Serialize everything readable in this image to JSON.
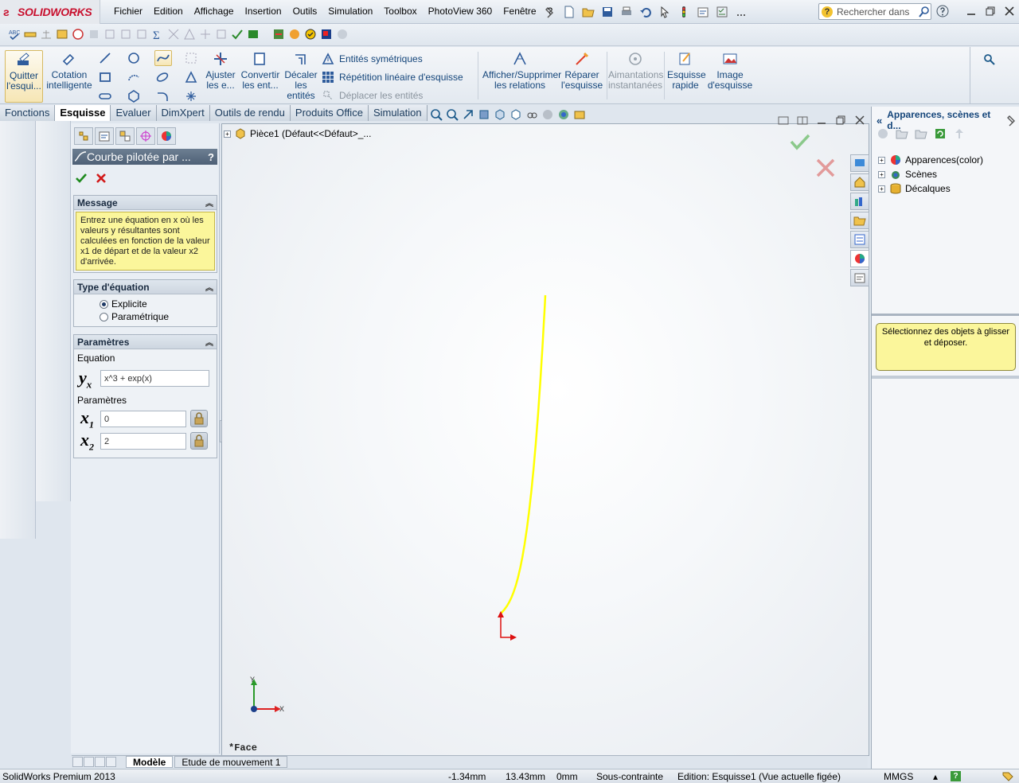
{
  "app": {
    "brand": "SOLIDWORKS",
    "product": "SolidWorks Premium 2013"
  },
  "menu": [
    "Fichier",
    "Edition",
    "Affichage",
    "Insertion",
    "Outils",
    "Simulation",
    "Toolbox",
    "PhotoView 360",
    "Fenêtre",
    "?"
  ],
  "search": {
    "placeholder": "Rechercher dans"
  },
  "ribbon": {
    "quit": "Quitter l'esqui...",
    "smartdim": "Cotation intelligente",
    "trim": "Ajuster les e...",
    "convert": "Convertir les ent...",
    "offset": "Décaler les entités",
    "mirror": "Entités symétriques",
    "linear": "Répétition linéaire d'esquisse",
    "move": "Déplacer les entités",
    "relations": "Afficher/Supprimer les relations",
    "repair": "Réparer l'esquisse",
    "snaps": "Aimantations instantanées",
    "quick": "Esquisse rapide",
    "picture": "Image d'esquisse"
  },
  "tabs": [
    "Fonctions",
    "Esquisse",
    "Evaluer",
    "DimXpert",
    "Outils de rendu",
    "Produits Office",
    "Simulation"
  ],
  "active_tab": "Esquisse",
  "property_manager": {
    "title": "Courbe pilotée par ...",
    "help": "?",
    "message_header": "Message",
    "message": "Entrez une équation en x où les valeurs y résultantes sont calculées en fonction de la valeur x1 de départ et de la valeur x2 d'arrivée.",
    "eqtype_header": "Type d'équation",
    "opt_explicit": "Explicite",
    "opt_param": "Paramétrique",
    "params_header": "Paramètres",
    "equation_label": "Equation",
    "equation_value": "x^3 + exp(x)",
    "params_label": "Paramètres",
    "x1_value": "0",
    "x2_value": "2",
    "y_symbol": "y",
    "y_sub": "x",
    "x_symbol": "x",
    "x1_sub": "1",
    "x2_sub": "2"
  },
  "feature_tree": {
    "root": "Pièce1  (Défaut<<Défaut>_..."
  },
  "viewport": {
    "face_label": "*Face",
    "axis_x": "X",
    "axis_y": "Y",
    "curve_color": "#ffff00"
  },
  "task_pane": {
    "title": "Apparences, scènes et d...",
    "items": [
      "Apparences(color)",
      "Scènes",
      "Décalques"
    ],
    "tip": "Sélectionnez des objets à glisser et déposer."
  },
  "bottom_tabs": [
    "Modèle",
    "Etude de mouvement 1"
  ],
  "status": {
    "x": "-1.34mm",
    "y": "13.43mm",
    "z": "0mm",
    "state": "Sous-contrainte",
    "edit": "Edition: Esquisse1 (Vue actuelle figée)",
    "units": "MMGS"
  }
}
